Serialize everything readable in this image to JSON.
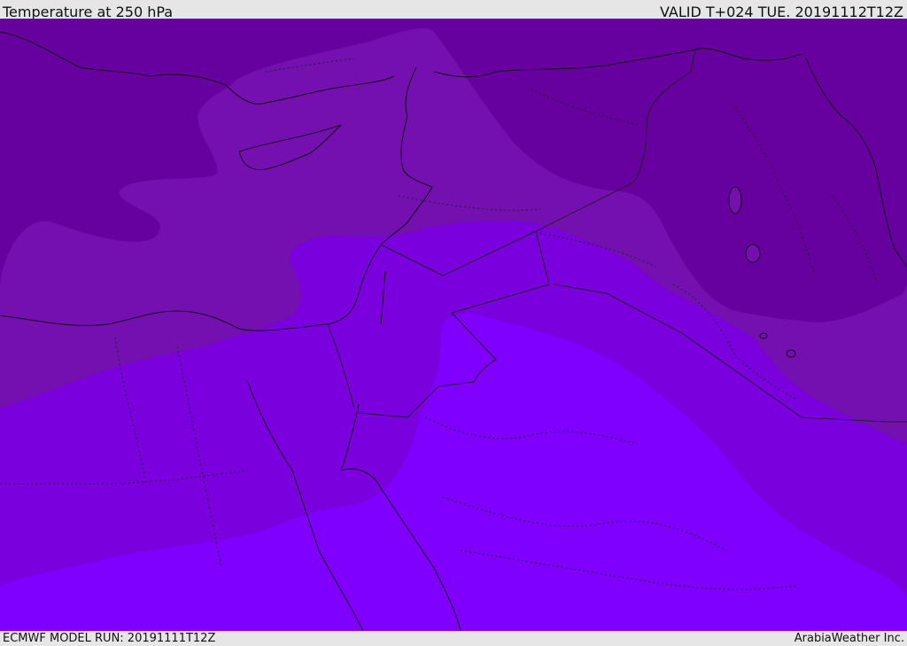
{
  "header": {
    "title": "Temperature at 250 hPa",
    "valid": "VALID T+024 TUE. 20191112T12Z"
  },
  "footer": {
    "model_run": "ECMWF MODEL RUN: 20191111T12Z",
    "credit": "ArabiaWeather Inc."
  },
  "colors": {
    "band_coldest": "#66009e",
    "band_cold": "#7410b0",
    "band_mid": "#7a00dd",
    "band_warm": "#7f00ff",
    "coastline": "#111111",
    "border": "#222222"
  }
}
